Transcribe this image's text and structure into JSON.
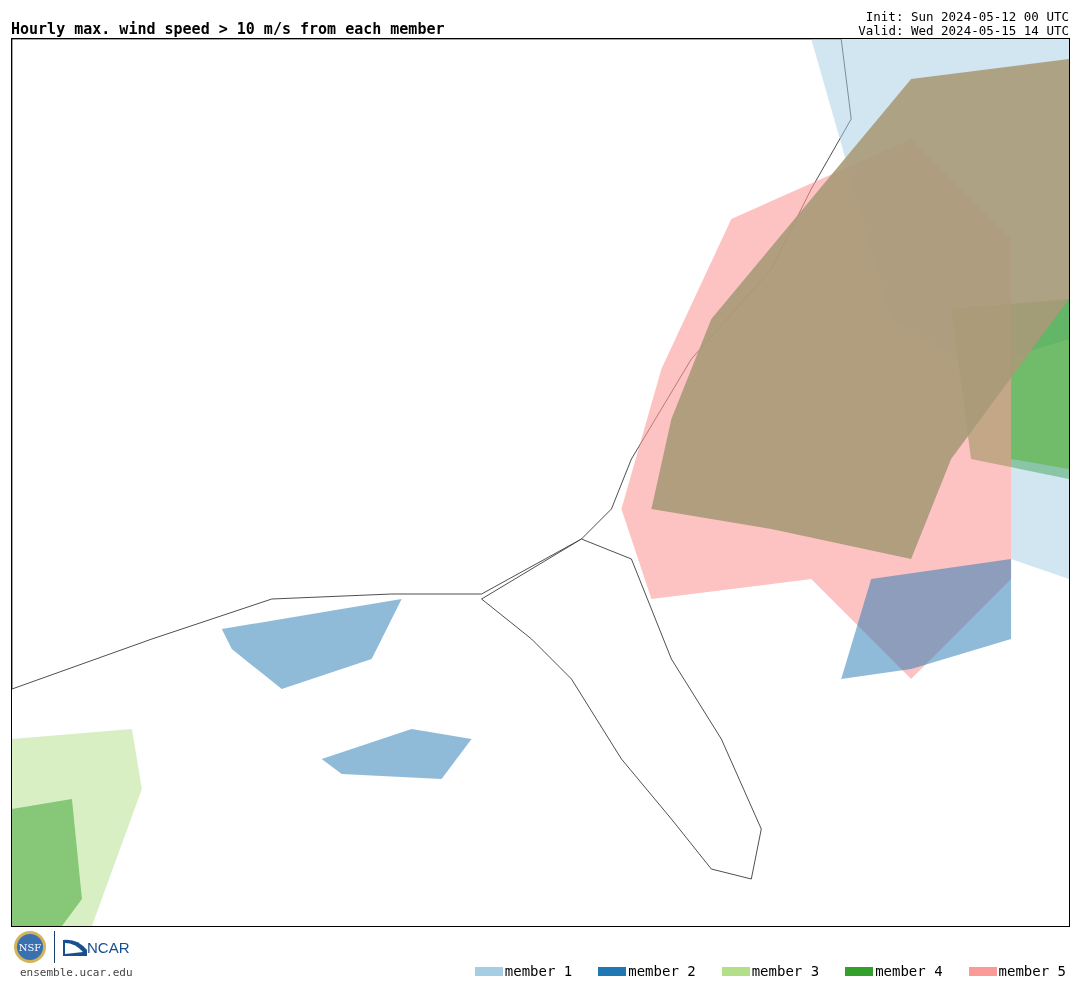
{
  "title": "Hourly max. wind speed > 10 m/s from each member",
  "init": "Init: Sun 2024-05-12 00 UTC",
  "valid": "Valid: Wed 2024-05-15 14 UTC",
  "logos": {
    "nsf": "NSF",
    "ncar": "NCAR"
  },
  "site": "ensemble.ucar.edu",
  "legend": [
    {
      "label": "member 1",
      "color": "#a6cee3"
    },
    {
      "label": "member 2",
      "color": "#1f78b4"
    },
    {
      "label": "member 3",
      "color": "#b2df8a"
    },
    {
      "label": "member 4",
      "color": "#33a02c"
    },
    {
      "label": "member 5",
      "color": "#fb9a99"
    }
  ]
}
